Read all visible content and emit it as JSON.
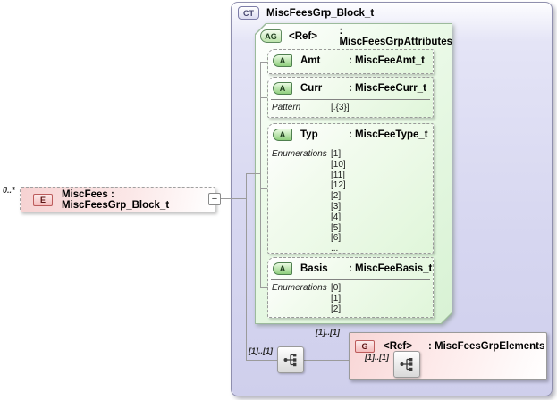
{
  "element": {
    "badge": "E",
    "occurrence": "0..*",
    "label": "MiscFees : MiscFeesGrp_Block_t",
    "collapse_glyph": "−"
  },
  "complex_type": {
    "badge": "CT",
    "title": "MiscFeesGrp_Block_t"
  },
  "attribute_group": {
    "badge": "AG",
    "name": "<Ref>",
    "type": ": MiscFeesGrpAttributes",
    "attributes": [
      {
        "badge": "A",
        "name": "Amt",
        "type": ": MiscFeeAmt_t"
      },
      {
        "badge": "A",
        "name": "Curr",
        "type": ": MiscFeeCurr_t",
        "facets": [
          {
            "label": "Pattern",
            "values": [
              "[.{3}]"
            ]
          }
        ]
      },
      {
        "badge": "A",
        "name": "Typ",
        "type": ": MiscFeeType_t",
        "facets": [
          {
            "label": "Enumerations",
            "values": [
              "[1]",
              "[10]",
              "[11]",
              "[12]",
              "[2]",
              "[3]",
              "[4]",
              "[5]",
              "[6]",
              "..."
            ]
          }
        ]
      },
      {
        "badge": "A",
        "name": "Basis",
        "type": ": MiscFeeBasis_t",
        "facets": [
          {
            "label": "Enumerations",
            "values": [
              "[0]",
              "[1]",
              "[2]"
            ]
          }
        ]
      }
    ]
  },
  "content_model": {
    "occurrence_sequence": "[1]..[1]",
    "occurrence_to_group": "[1]..[1]",
    "group": {
      "badge": "G",
      "name": "<Ref>",
      "type": ": MiscFeesGrpElements",
      "occurrence_inner": "[1]..[1]"
    }
  },
  "icons": {
    "sequence": "sequence-compositor-icon"
  },
  "colors": {
    "panel_lavender": "#d6d6f0",
    "panel_green": "#d8f2d4",
    "box_pink": "#f6d2d2",
    "connector_gray": "#9b9b9b",
    "badge_green_border": "#4f7f4f",
    "badge_red_border": "#bc5c5c"
  }
}
